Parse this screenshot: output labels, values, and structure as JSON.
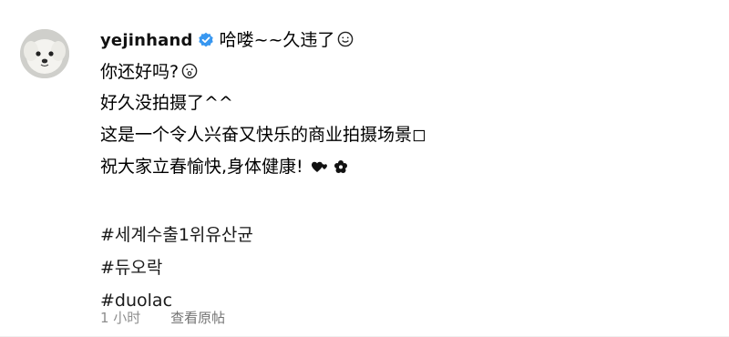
{
  "comment": {
    "username": "yejinhand",
    "verified": true,
    "greeting": "哈喽~~久违了",
    "lines": [
      "你还好吗?",
      "好久没拍摄了^^",
      "这是一个令人兴奋又快乐的商业拍摄场景◻",
      "祝大家立春愉快,身体健康!"
    ],
    "emoji_icons": [
      "smiling-face-icon",
      "surprised-face-icon",
      "hearts-icon",
      "flower-icon"
    ],
    "hashtags": [
      "#세계수출1위유산균",
      "#듀오락",
      "#duolac"
    ],
    "timestamp": "1 小时",
    "view_original_label": "查看原帖"
  },
  "colors": {
    "verified_badge": "#3897f0",
    "meta_text": "#8e8e8e"
  }
}
